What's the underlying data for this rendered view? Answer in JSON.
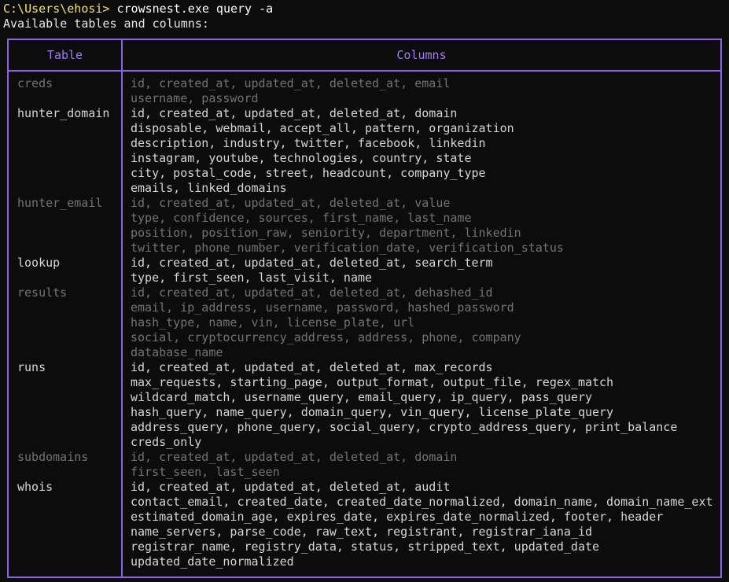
{
  "terminal": {
    "prompt": "C:\\Users\\ehosi>",
    "command": " crowsnest.exe query -a",
    "heading": "Available tables and columns:"
  },
  "table": {
    "header_table": "Table",
    "header_columns": "Columns",
    "rows": [
      {
        "name": "creds",
        "style": "dim",
        "lines": [
          "id, created_at, updated_at, deleted_at, email",
          "username, password"
        ]
      },
      {
        "name": "hunter_domain",
        "style": "bright",
        "lines": [
          "id, created_at, updated_at, deleted_at, domain",
          "disposable, webmail, accept_all, pattern, organization",
          "description, industry, twitter, facebook, linkedin",
          "instagram, youtube, technologies, country, state",
          "city, postal_code, street, headcount, company_type",
          "emails, linked_domains"
        ]
      },
      {
        "name": "hunter_email",
        "style": "dim",
        "lines": [
          "id, created_at, updated_at, deleted_at, value",
          "type, confidence, sources, first_name, last_name",
          "position, position_raw, seniority, department, linkedin",
          "twitter, phone_number, verification_date, verification_status"
        ]
      },
      {
        "name": "lookup",
        "style": "bright",
        "lines": [
          "id, created_at, updated_at, deleted_at, search_term",
          "type, first_seen, last_visit, name"
        ]
      },
      {
        "name": "results",
        "style": "dim",
        "lines": [
          "id, created_at, updated_at, deleted_at, dehashed_id",
          "email, ip_address, username, password, hashed_password",
          "hash_type, name, vin, license_plate, url",
          "social, cryptocurrency_address, address, phone, company",
          "database_name"
        ]
      },
      {
        "name": "runs",
        "style": "bright",
        "lines": [
          "id, created_at, updated_at, deleted_at, max_records",
          "max_requests, starting_page, output_format, output_file, regex_match",
          "wildcard_match, username_query, email_query, ip_query, pass_query",
          "hash_query, name_query, domain_query, vin_query, license_plate_query",
          "address_query, phone_query, social_query, crypto_address_query, print_balance",
          "creds_only"
        ]
      },
      {
        "name": "subdomains",
        "style": "dim",
        "lines": [
          "id, created_at, updated_at, deleted_at, domain",
          "first_seen, last_seen"
        ]
      },
      {
        "name": "whois",
        "style": "bright",
        "lines": [
          "id, created_at, updated_at, deleted_at, audit",
          "contact_email, created_date, created_date_normalized, domain_name, domain_name_ext",
          "estimated_domain_age, expires_date, expires_date_normalized, footer, header",
          "name_servers, parse_code, raw_text, registrant, registrar_iana_id",
          "registrar_name, registry_data, status, stripped_text, updated_date",
          "updated_date_normalized"
        ]
      }
    ]
  }
}
